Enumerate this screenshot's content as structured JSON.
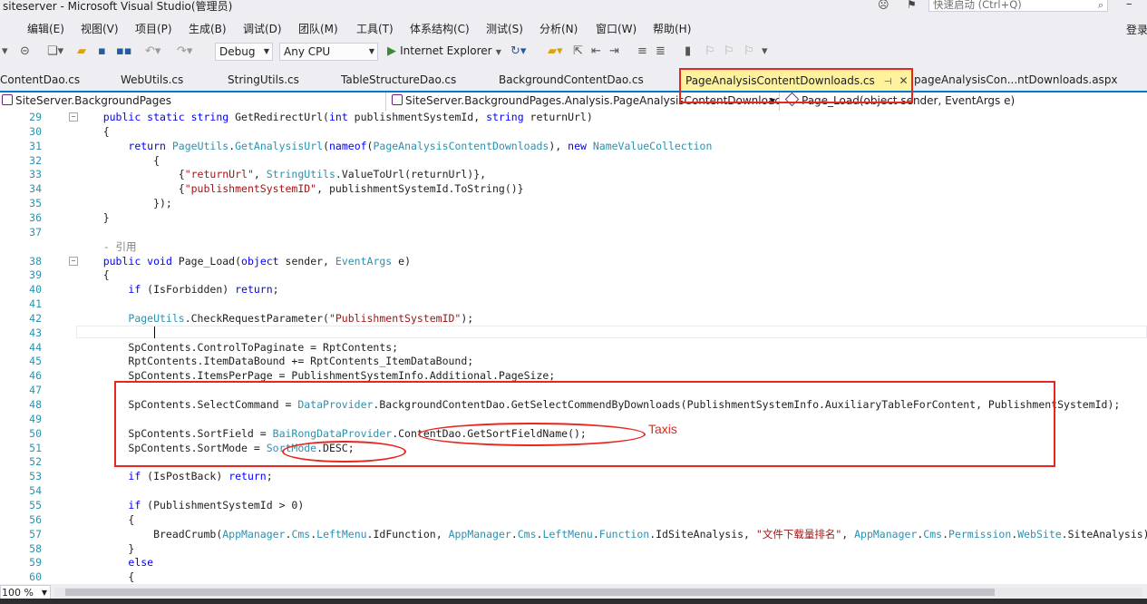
{
  "window": {
    "title": "siteserver - Microsoft Visual Studio(管理员)",
    "quick_launch_placeholder": "快速启动 (Ctrl+Q)",
    "login_label": "登录"
  },
  "menu": [
    "编辑(E)",
    "视图(V)",
    "项目(P)",
    "生成(B)",
    "调试(D)",
    "团队(M)",
    "工具(T)",
    "体系结构(C)",
    "测试(S)",
    "分析(N)",
    "窗口(W)",
    "帮助(H)"
  ],
  "toolbar": {
    "configuration": "Debug",
    "platform": "Any CPU",
    "run_target": "Internet Explorer"
  },
  "tabs": [
    "ContentDao.cs",
    "WebUtils.cs",
    "StringUtils.cs",
    "TableStructureDao.cs",
    "BackgroundContentDao.cs",
    "PageAnalysisContentDownloads.cs",
    "pageAnalysisCon...ntDownloads.aspx"
  ],
  "active_tab": "PageAnalysisContentDownloads.cs",
  "navbar": {
    "project": "SiteServer.BackgroundPages",
    "type": "SiteServer.BackgroundPages.Analysis.PageAnalysisContentDownloac",
    "member": "Page_Load(object sender, EventArgs e)"
  },
  "code_lines": [
    {
      "n": "29",
      "segs": [
        [
          "p",
          "    "
        ],
        [
          "kw",
          "public static string"
        ],
        [
          "p",
          " GetRedirectUrl("
        ],
        [
          "kw",
          "int"
        ],
        [
          "p",
          " publishmentSystemId, "
        ],
        [
          "kw",
          "string"
        ],
        [
          "p",
          " returnUrl)"
        ]
      ]
    },
    {
      "n": "30",
      "segs": [
        [
          "p",
          "    {"
        ]
      ]
    },
    {
      "n": "31",
      "segs": [
        [
          "p",
          "        "
        ],
        [
          "kw",
          "return"
        ],
        [
          "p",
          " "
        ],
        [
          "ty",
          "PageUtils"
        ],
        [
          "p",
          "."
        ],
        [
          "ty",
          "GetAnalysisUrl"
        ],
        [
          "p",
          "("
        ],
        [
          "kw",
          "nameof"
        ],
        [
          "p",
          "("
        ],
        [
          "ty",
          "PageAnalysisContentDownloads"
        ],
        [
          "p",
          "), "
        ],
        [
          "kw",
          "new"
        ],
        [
          "p",
          " "
        ],
        [
          "ty",
          "NameValueCollection"
        ]
      ]
    },
    {
      "n": "32",
      "segs": [
        [
          "p",
          "            {"
        ]
      ]
    },
    {
      "n": "33",
      "segs": [
        [
          "p",
          "                {"
        ],
        [
          "st",
          "\"returnUrl\""
        ],
        [
          "p",
          ", "
        ],
        [
          "ty",
          "StringUtils"
        ],
        [
          "p",
          ".ValueToUrl(returnUrl)},"
        ]
      ]
    },
    {
      "n": "34",
      "segs": [
        [
          "p",
          "                {"
        ],
        [
          "st",
          "\"publishmentSystemID\""
        ],
        [
          "p",
          ", publishmentSystemId.ToString()}"
        ]
      ]
    },
    {
      "n": "35",
      "segs": [
        [
          "p",
          "            });"
        ]
      ]
    },
    {
      "n": "36",
      "segs": [
        [
          "p",
          "    }"
        ]
      ]
    },
    {
      "n": "37",
      "segs": [
        [
          "p",
          ""
        ]
      ]
    },
    {
      "n": "",
      "segs": [
        [
          "cm",
          "    - 引用"
        ]
      ]
    },
    {
      "n": "38",
      "segs": [
        [
          "p",
          "    "
        ],
        [
          "kw",
          "public void"
        ],
        [
          "p",
          " Page_Load("
        ],
        [
          "kw",
          "object"
        ],
        [
          "p",
          " sender, "
        ],
        [
          "ty",
          "EventArgs"
        ],
        [
          "p",
          " e)"
        ]
      ]
    },
    {
      "n": "39",
      "segs": [
        [
          "p",
          "    {"
        ]
      ]
    },
    {
      "n": "40",
      "segs": [
        [
          "p",
          "        "
        ],
        [
          "kw",
          "if"
        ],
        [
          "p",
          " (IsForbidden) "
        ],
        [
          "kw",
          "return"
        ],
        [
          "p",
          ";"
        ]
      ]
    },
    {
      "n": "41",
      "segs": [
        [
          "p",
          ""
        ]
      ]
    },
    {
      "n": "42",
      "segs": [
        [
          "p",
          "        "
        ],
        [
          "ty",
          "PageUtils"
        ],
        [
          "p",
          ".CheckRequestParameter("
        ],
        [
          "st",
          "\"PublishmentSystemID\""
        ],
        [
          "p",
          ");"
        ]
      ]
    },
    {
      "n": "43",
      "segs": [
        [
          "p",
          ""
        ]
      ]
    },
    {
      "n": "44",
      "segs": [
        [
          "p",
          "        SpContents.ControlToPaginate = RptContents;"
        ]
      ]
    },
    {
      "n": "45",
      "segs": [
        [
          "p",
          "        RptContents.ItemDataBound += RptContents_ItemDataBound;"
        ]
      ]
    },
    {
      "n": "46",
      "segs": [
        [
          "p",
          "        SpContents.ItemsPerPage = PublishmentSystemInfo.Additional.PageSize;"
        ]
      ]
    },
    {
      "n": "47",
      "segs": [
        [
          "p",
          ""
        ]
      ]
    },
    {
      "n": "48",
      "segs": [
        [
          "p",
          "        SpContents.SelectCommand = "
        ],
        [
          "ty",
          "DataProvider"
        ],
        [
          "p",
          ".BackgroundContentDao.GetSelectCommendByDownloads(PublishmentSystemInfo.AuxiliaryTableForContent, PublishmentSystemId);"
        ]
      ]
    },
    {
      "n": "49",
      "segs": [
        [
          "p",
          ""
        ]
      ]
    },
    {
      "n": "50",
      "segs": [
        [
          "p",
          "        SpContents.SortField = "
        ],
        [
          "ty",
          "BaiRongDataProvider"
        ],
        [
          "p",
          ".ContentDao.GetSortFieldName();"
        ]
      ]
    },
    {
      "n": "51",
      "segs": [
        [
          "p",
          "        SpContents.SortMode = "
        ],
        [
          "ty",
          "SortMode"
        ],
        [
          "p",
          ".DESC;"
        ]
      ]
    },
    {
      "n": "52",
      "segs": [
        [
          "p",
          ""
        ]
      ]
    },
    {
      "n": "53",
      "segs": [
        [
          "p",
          "        "
        ],
        [
          "kw",
          "if"
        ],
        [
          "p",
          " (IsPostBack) "
        ],
        [
          "kw",
          "return"
        ],
        [
          "p",
          ";"
        ]
      ]
    },
    {
      "n": "54",
      "segs": [
        [
          "p",
          ""
        ]
      ]
    },
    {
      "n": "55",
      "segs": [
        [
          "p",
          "        "
        ],
        [
          "kw",
          "if"
        ],
        [
          "p",
          " (PublishmentSystemId > 0)"
        ]
      ]
    },
    {
      "n": "56",
      "segs": [
        [
          "p",
          "        {"
        ]
      ]
    },
    {
      "n": "57",
      "segs": [
        [
          "p",
          "            BreadCrumb("
        ],
        [
          "ty",
          "AppManager"
        ],
        [
          "p",
          "."
        ],
        [
          "ty",
          "Cms"
        ],
        [
          "p",
          "."
        ],
        [
          "ty",
          "LeftMenu"
        ],
        [
          "p",
          ".IdFunction, "
        ],
        [
          "ty",
          "AppManager"
        ],
        [
          "p",
          "."
        ],
        [
          "ty",
          "Cms"
        ],
        [
          "p",
          "."
        ],
        [
          "ty",
          "LeftMenu"
        ],
        [
          "p",
          "."
        ],
        [
          "ty",
          "Function"
        ],
        [
          "p",
          ".IdSiteAnalysis, "
        ],
        [
          "st",
          "\"文件下载量排名\""
        ],
        [
          "p",
          ", "
        ],
        [
          "ty",
          "AppManager"
        ],
        [
          "p",
          "."
        ],
        [
          "ty",
          "Cms"
        ],
        [
          "p",
          "."
        ],
        [
          "ty",
          "Permission"
        ],
        [
          "p",
          "."
        ],
        [
          "ty",
          "WebSite"
        ],
        [
          "p",
          ".SiteAnalysis);"
        ]
      ]
    },
    {
      "n": "58",
      "segs": [
        [
          "p",
          "        }"
        ]
      ]
    },
    {
      "n": "59",
      "segs": [
        [
          "p",
          "        "
        ],
        [
          "kw",
          "else"
        ]
      ]
    },
    {
      "n": "60",
      "segs": [
        [
          "p",
          "        {"
        ]
      ]
    }
  ],
  "annotation": "Taxis",
  "zoom": "100 %",
  "colors": {
    "accent": "#007ACC",
    "active_tab": "#FFF29D",
    "annotation_red": "#E8251E",
    "keyword": "#0000FF",
    "type": "#2B91AF",
    "string": "#A31515"
  }
}
